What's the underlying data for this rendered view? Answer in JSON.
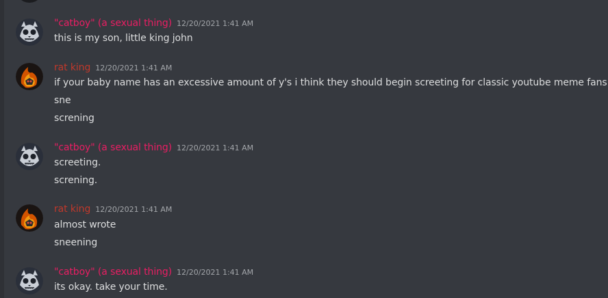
{
  "colors": {
    "background": "#36393f",
    "catboy_name": "#e91e63",
    "ratking_name": "#c0392b",
    "text": "#dcddde",
    "timestamp": "#a3a6aa"
  },
  "messages": [
    {
      "author": "\"catboy\" (a sexual thing)",
      "timestamp": "12/20/2021 1:41 AM",
      "avatar_icon": "cat-skull-avatar-icon",
      "lines": [
        "this is my son, little king john"
      ]
    },
    {
      "author": "rat king",
      "timestamp": "12/20/2021 1:41 AM",
      "avatar_icon": "fire-avatar-icon",
      "lines": [
        "if your baby name has an excessive amount of y's i think they should begin screeting for classic youtube meme fans",
        "sne",
        "screning"
      ]
    },
    {
      "author": "\"catboy\" (a sexual thing)",
      "timestamp": "12/20/2021 1:41 AM",
      "avatar_icon": "cat-skull-avatar-icon",
      "lines": [
        "screeting.",
        "screning."
      ]
    },
    {
      "author": "rat king",
      "timestamp": "12/20/2021 1:41 AM",
      "avatar_icon": "fire-avatar-icon",
      "lines": [
        "almost wrote",
        "sneening"
      ]
    },
    {
      "author": "\"catboy\" (a sexual thing)",
      "timestamp": "12/20/2021 1:41 AM",
      "avatar_icon": "cat-skull-avatar-icon",
      "lines": [
        "its okay. take your time."
      ]
    }
  ]
}
